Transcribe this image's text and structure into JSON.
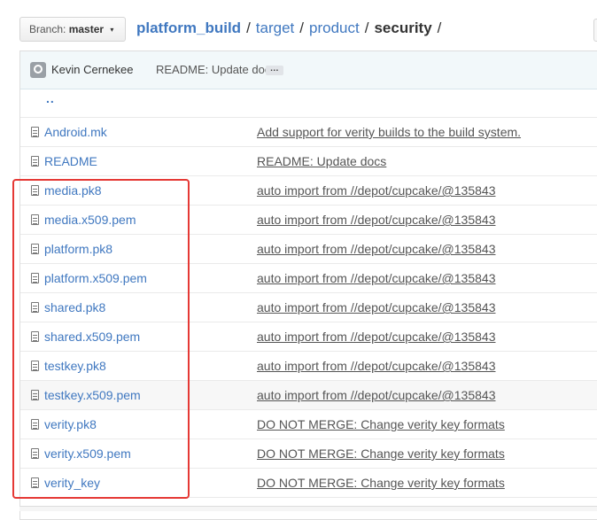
{
  "branch": {
    "label": "Branch:",
    "value": "master",
    "caret": "▾"
  },
  "breadcrumb": {
    "repo": "platform_build",
    "sep": "/",
    "path": [
      "target",
      "product"
    ],
    "current": "security",
    "trail": "/"
  },
  "commit": {
    "author": "Kevin Cernekee",
    "message": "README: Update docs",
    "ellipsis": "…"
  },
  "parent_dir": "..",
  "files": [
    {
      "name": "Android.mk",
      "message": "Add support for verity builds to the build system."
    },
    {
      "name": "README",
      "message": "README: Update docs"
    },
    {
      "name": "media.pk8",
      "message": "auto import from //depot/cupcake/@135843"
    },
    {
      "name": "media.x509.pem",
      "message": "auto import from //depot/cupcake/@135843"
    },
    {
      "name": "platform.pk8",
      "message": "auto import from //depot/cupcake/@135843"
    },
    {
      "name": "platform.x509.pem",
      "message": "auto import from //depot/cupcake/@135843"
    },
    {
      "name": "shared.pk8",
      "message": "auto import from //depot/cupcake/@135843"
    },
    {
      "name": "shared.x509.pem",
      "message": "auto import from //depot/cupcake/@135843"
    },
    {
      "name": "testkey.pk8",
      "message": "auto import from //depot/cupcake/@135843"
    },
    {
      "name": "testkey.x509.pem",
      "message": "auto import from //depot/cupcake/@135843"
    },
    {
      "name": "verity.pk8",
      "message": "DO NOT MERGE: Change verity key formats"
    },
    {
      "name": "verity.x509.pem",
      "message": "DO NOT MERGE: Change verity key formats"
    },
    {
      "name": "verity_key",
      "message": "DO NOT MERGE: Change verity key formats"
    }
  ],
  "icons": {
    "file": "file-text-icon",
    "avatar": "github-avatar-icon"
  },
  "colors": {
    "link": "#4078c0",
    "highlight": "#e53935",
    "commit_bg": "#f2f8fa"
  }
}
